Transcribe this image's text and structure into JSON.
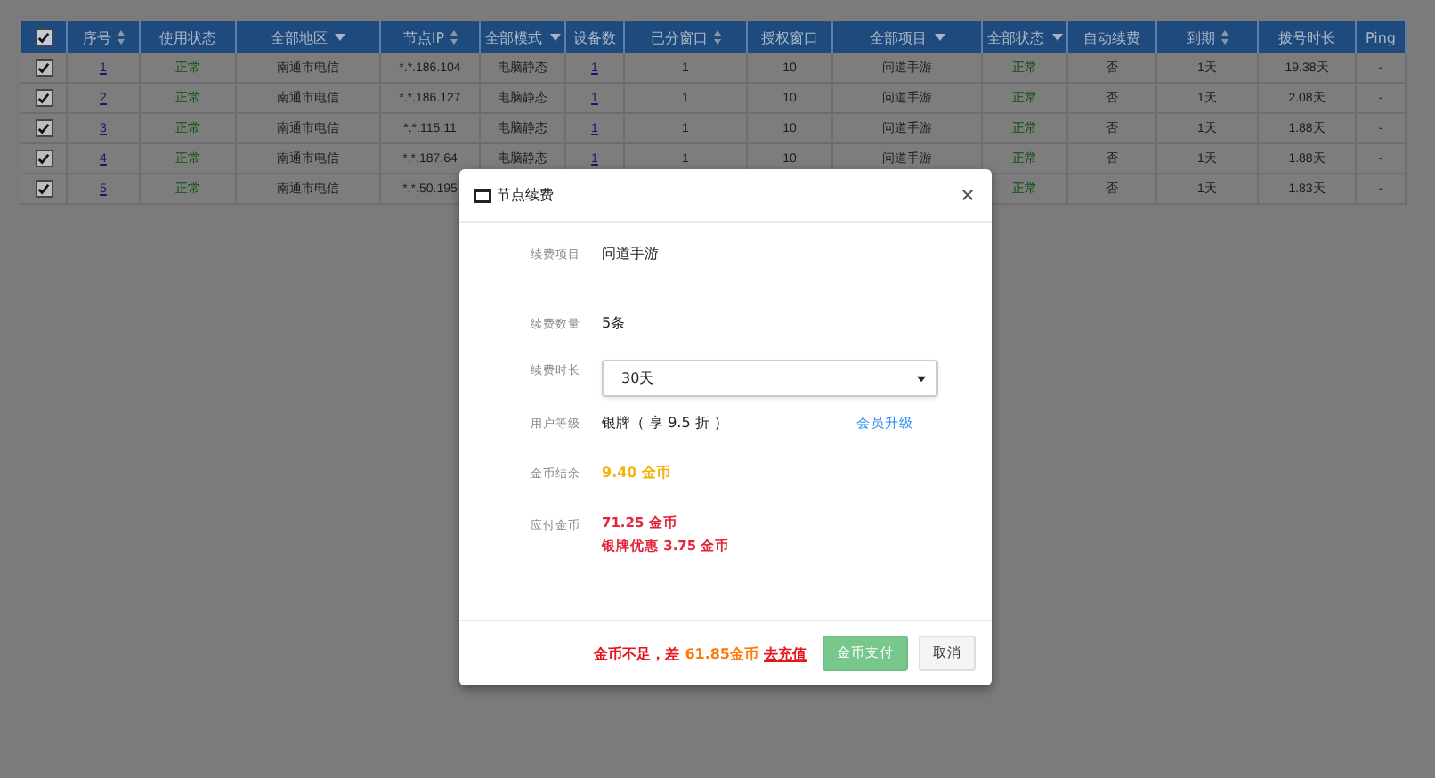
{
  "table": {
    "header_checkbox": {
      "checked": true
    },
    "columns": [
      {
        "label": "序号",
        "kind": "sort"
      },
      {
        "label": "使用状态",
        "kind": "plain"
      },
      {
        "label": "全部地区",
        "kind": "filter"
      },
      {
        "label": "节点IP",
        "kind": "sort"
      },
      {
        "label": "全部模式",
        "kind": "filter"
      },
      {
        "label": "设备数",
        "kind": "plain"
      },
      {
        "label": "已分窗口",
        "kind": "sort"
      },
      {
        "label": "授权窗口",
        "kind": "plain"
      },
      {
        "label": "全部项目",
        "kind": "filter"
      },
      {
        "label": "全部状态",
        "kind": "filter"
      },
      {
        "label": "自动续费",
        "kind": "plain"
      },
      {
        "label": "到期",
        "kind": "sort"
      },
      {
        "label": "拨号时长",
        "kind": "plain"
      },
      {
        "label": "Ping",
        "kind": "plain"
      }
    ],
    "rows": [
      {
        "checked": true,
        "cells": [
          "1",
          "正常",
          "南通市电信",
          "*.*.186.104",
          "电脑静态",
          "1",
          "1",
          "10",
          "问道手游",
          "正常",
          "否",
          "1天",
          "19.38天",
          "-"
        ]
      },
      {
        "checked": true,
        "cells": [
          "2",
          "正常",
          "南通市电信",
          "*.*.186.127",
          "电脑静态",
          "1",
          "1",
          "10",
          "问道手游",
          "正常",
          "否",
          "1天",
          "2.08天",
          "-"
        ]
      },
      {
        "checked": true,
        "cells": [
          "3",
          "正常",
          "南通市电信",
          "*.*.115.11",
          "电脑静态",
          "1",
          "1",
          "10",
          "问道手游",
          "正常",
          "否",
          "1天",
          "1.88天",
          "-"
        ]
      },
      {
        "checked": true,
        "cells": [
          "4",
          "正常",
          "南通市电信",
          "*.*.187.64",
          "电脑静态",
          "1",
          "1",
          "10",
          "问道手游",
          "正常",
          "否",
          "1天",
          "1.88天",
          "-"
        ]
      },
      {
        "checked": true,
        "cells": [
          "5",
          "正常",
          "南通市电信",
          "*.*.50.195",
          "",
          "",
          "",
          "",
          "",
          "正常",
          "否",
          "1天",
          "1.83天",
          "-"
        ]
      }
    ]
  },
  "dialog": {
    "title": "节点续费",
    "fields": [
      {
        "kind": "text",
        "label": "续费项目",
        "value": "问道手游"
      },
      {
        "kind": "text",
        "label": "续费数量",
        "value": "5条"
      },
      {
        "kind": "select",
        "label": "续费时长",
        "value": "30天"
      },
      {
        "kind": "level",
        "label": "用户等级",
        "value": "银牌（ 享 9.5 折 ）",
        "link": "会员升级"
      },
      {
        "kind": "balance",
        "label": "金币结余",
        "value": "9.40 金币"
      },
      {
        "kind": "due",
        "label": "应付金币",
        "value": "71.25 金币",
        "note": "银牌优惠 3.75 金币"
      }
    ],
    "warning": "金币不足，差",
    "shortfall": "61.85金币",
    "recharge_link": "去充值",
    "buttons": [
      {
        "label": "金币支付",
        "kind": "primary",
        "disabled": true
      },
      {
        "label": "取消",
        "kind": "default",
        "disabled": false
      }
    ]
  }
}
